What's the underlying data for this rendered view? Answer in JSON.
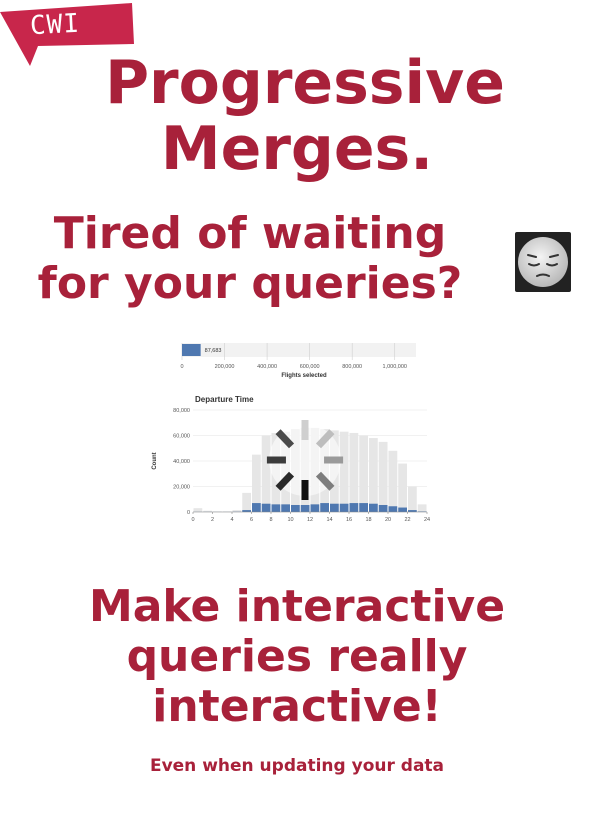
{
  "logo": {
    "text": "CWI",
    "color": "#c8264b"
  },
  "title": {
    "line1": "Progressive",
    "line2": "Merges."
  },
  "question": {
    "line1": "Tired of waiting",
    "line2": "for your queries?"
  },
  "emoji_icon": "pensive-face-icon",
  "tagline": {
    "line1": "Make interactive",
    "line2": "queries really",
    "line3": "interactive!"
  },
  "subtitle": "Even when updating your data",
  "colors": {
    "accent": "#a8213a",
    "bar_selected": "#4f78b0",
    "bar_total": "#e6e6e6"
  },
  "chart_data": [
    {
      "type": "bar",
      "orientation": "horizontal",
      "title": "Flights selected",
      "values": [
        87683
      ],
      "value_label": "87,683",
      "ticks": [
        "0",
        "200,000",
        "400,000",
        "600,000",
        "800,000",
        "1,000,000"
      ],
      "xlim": [
        0,
        1100000
      ]
    },
    {
      "type": "bar",
      "title": "Departure Time",
      "ylabel": "Count",
      "x_ticks": [
        "0",
        "2",
        "4",
        "6",
        "8",
        "10",
        "12",
        "14",
        "16",
        "18",
        "20",
        "22",
        "24"
      ],
      "y_ticks": [
        "0",
        "20,000",
        "40,000",
        "60,000",
        "80,000"
      ],
      "xlim": [
        0,
        24
      ],
      "ylim": [
        0,
        80000
      ],
      "x": [
        0.5,
        1.5,
        2.5,
        3.5,
        4.5,
        5.5,
        6.5,
        7.5,
        8.5,
        9.5,
        10.5,
        11.5,
        12.5,
        13.5,
        14.5,
        15.5,
        16.5,
        17.5,
        18.5,
        19.5,
        20.5,
        21.5,
        22.5,
        23.5
      ],
      "series": [
        {
          "values": [
            3000,
            1000,
            500,
            500,
            1500,
            15000,
            45000,
            60000,
            62000,
            63000,
            65000,
            66000,
            66000,
            65000,
            64000,
            63000,
            62000,
            60000,
            58000,
            55000,
            48000,
            38000,
            20000,
            6000
          ]
        },
        {
          "values": [
            100,
            100,
            50,
            50,
            200,
            1500,
            7000,
            6500,
            6000,
            6000,
            5500,
            5500,
            6000,
            7000,
            6500,
            6500,
            7000,
            7000,
            6500,
            5500,
            4500,
            3500,
            1500,
            400
          ]
        }
      ]
    }
  ]
}
